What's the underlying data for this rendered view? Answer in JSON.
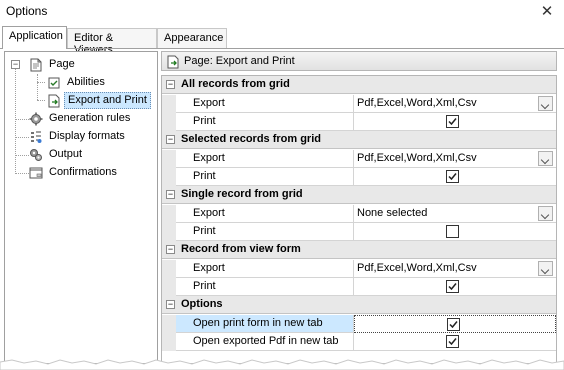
{
  "window": {
    "title": "Options"
  },
  "tabs": [
    {
      "label": "Application",
      "active": true
    },
    {
      "label": "Editor & Viewers",
      "active": false
    },
    {
      "label": "Appearance",
      "active": false
    }
  ],
  "tree": {
    "page": {
      "label": "Page",
      "icon": "page-icon"
    },
    "abilities": {
      "label": "Abilities",
      "icon": "abilities-icon"
    },
    "export_print": {
      "label": "Export and Print",
      "icon": "export-print-icon",
      "selected": true
    },
    "generation_rules": {
      "label": "Generation rules",
      "icon": "gear-icon"
    },
    "display_formats": {
      "label": "Display formats",
      "icon": "format-icon"
    },
    "output": {
      "label": "Output",
      "icon": "output-icon"
    },
    "confirmations": {
      "label": "Confirmations",
      "icon": "confirmation-icon"
    }
  },
  "panel": {
    "header": "Page: Export and Print"
  },
  "grid": {
    "sections": [
      {
        "title": "All records from grid",
        "export_label": "Export",
        "export_value": "Pdf,Excel,Word,Xml,Csv",
        "print_label": "Print",
        "print_checked": true
      },
      {
        "title": "Selected records from grid",
        "export_label": "Export",
        "export_value": "Pdf,Excel,Word,Xml,Csv",
        "print_label": "Print",
        "print_checked": true
      },
      {
        "title": "Single record from grid",
        "export_label": "Export",
        "export_value": "None selected",
        "print_label": "Print",
        "print_checked": false
      },
      {
        "title": "Record from view form",
        "export_label": "Export",
        "export_value": "Pdf,Excel,Word,Xml,Csv",
        "print_label": "Print",
        "print_checked": true
      }
    ],
    "options": {
      "title": "Options",
      "open_print_label": "Open print form in new tab",
      "open_print_checked": true,
      "open_pdf_label": "Open exported Pdf in new tab",
      "open_pdf_checked": true
    }
  }
}
